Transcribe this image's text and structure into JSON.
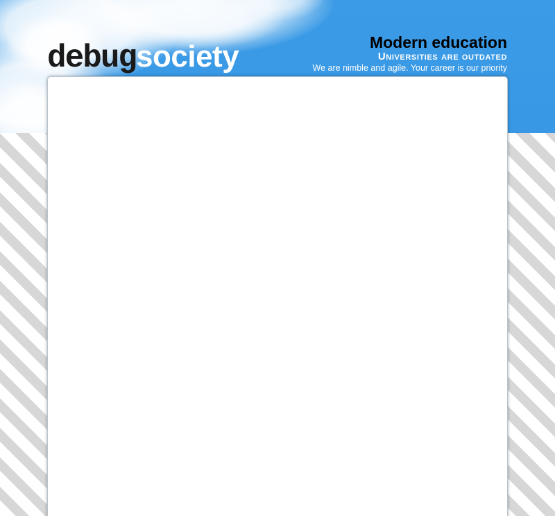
{
  "logo": {
    "part1": "debug",
    "part2": "society"
  },
  "tagline": {
    "title": "Modern education",
    "subtitle": "Universities are outdated",
    "description": "We are nimble and agile. Your career is our priority"
  },
  "colors": {
    "sky_blue": "#3898e6",
    "stripe_gray": "#d7d7d7",
    "panel_white": "#ffffff",
    "logo_dark": "#1a1a1a"
  }
}
